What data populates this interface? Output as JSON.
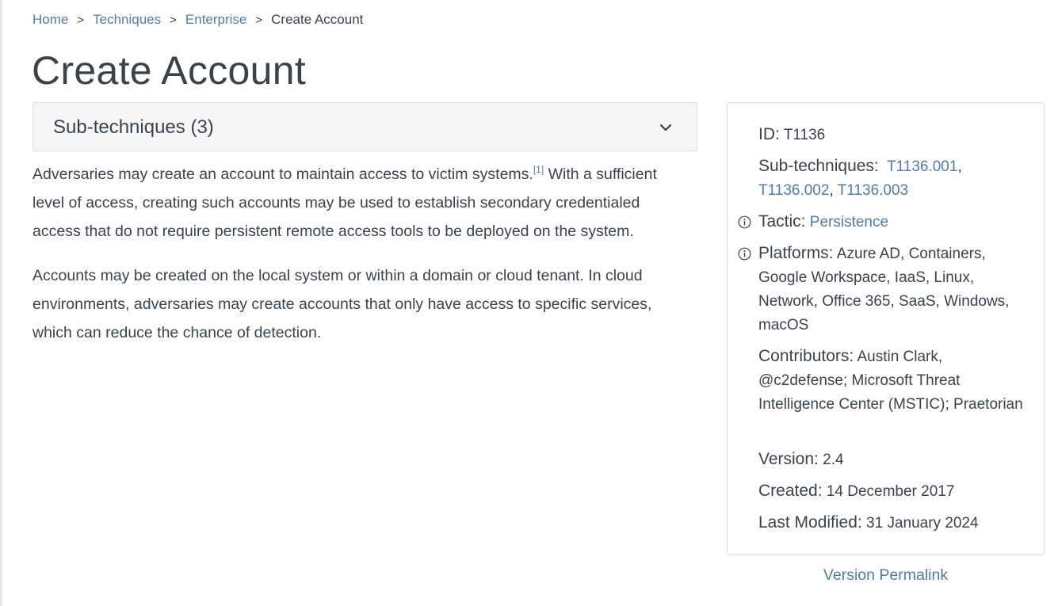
{
  "breadcrumb": {
    "items": [
      "Home",
      "Techniques",
      "Enterprise"
    ],
    "separator": ">",
    "current": "Create Account"
  },
  "title": "Create Account",
  "subtechniques": {
    "label": "Sub-techniques (3)",
    "icon": "chevron-down-icon"
  },
  "description": {
    "p1_before": "Adversaries may create an account to maintain access to victim systems.",
    "p1_citation": "[1]",
    "p1_after": " With a sufficient level of access, creating such accounts may be used to establish secondary credentialed access that do not require persistent remote access tools to be deployed on the system.",
    "p2": "Accounts may be created on the local system or within a domain or cloud tenant. In cloud environments, adversaries may create accounts that only have access to specific services, which can reduce the chance of detection."
  },
  "card": {
    "id_label": "ID:",
    "id_value": "T1136",
    "subtech_label": "Sub-techniques:",
    "subtech_links": [
      "T1136.001",
      "T1136.002",
      "T1136.003"
    ],
    "subtech_sep": ",",
    "tactic_label": "Tactic:",
    "tactic_value": "Persistence",
    "platforms_label": "Platforms:",
    "platforms_value": "Azure AD, Containers, Google Workspace, IaaS, Linux, Network, Office 365, SaaS, Windows, macOS",
    "contributors_label": "Contributors:",
    "contributors_value": "Austin Clark, @c2defense; Microsoft Threat Intelligence Center (MSTIC); Praetorian",
    "version_label": "Version:",
    "version_value": "2.4",
    "created_label": "Created:",
    "created_value": "14 December 2017",
    "modified_label": "Last Modified:",
    "modified_value": "31 January 2024",
    "info_icon": "info-circle-icon"
  },
  "permalink": "Version Permalink",
  "colors": {
    "link": "#4f7cac",
    "text": "#39434c",
    "panel_bg": "#f6f6f6",
    "border": "#dcdcdc"
  }
}
